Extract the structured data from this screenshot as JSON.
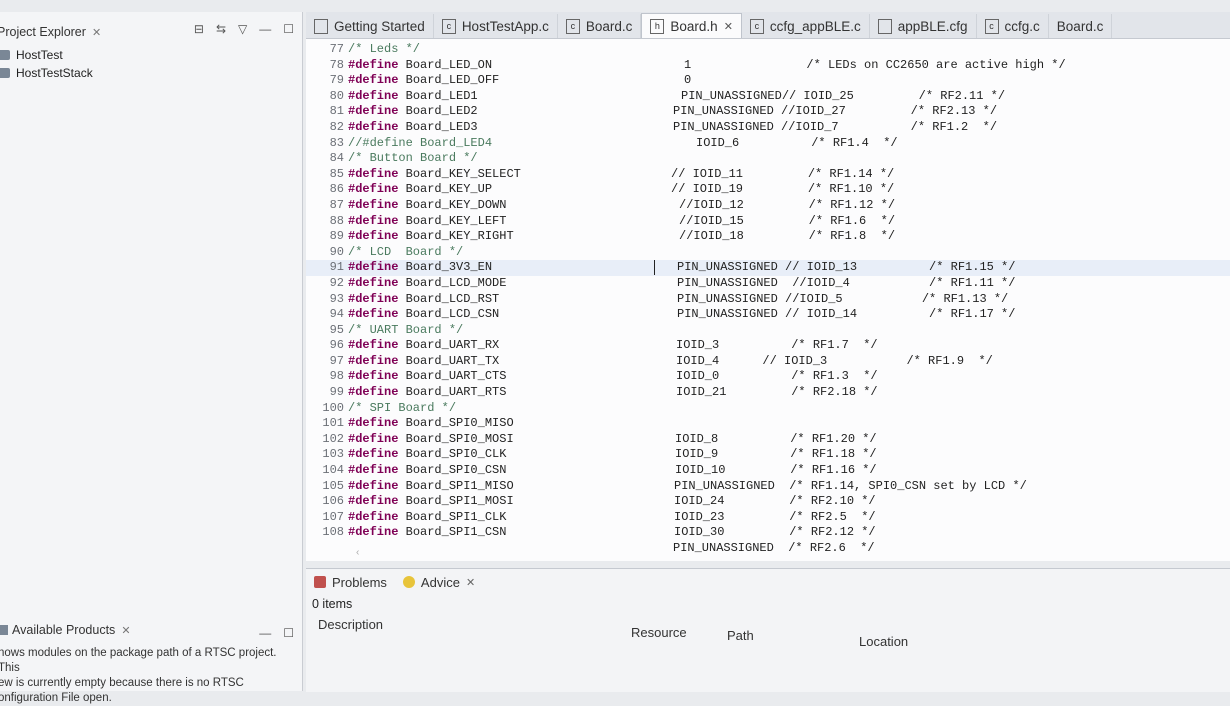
{
  "project_explorer": {
    "title": "Project Explorer",
    "close": "✕",
    "items": [
      "HostTest",
      "HostTestStack"
    ]
  },
  "available_products": {
    "title": "Available Products",
    "close": "✕",
    "message": [
      "nows modules on the package path of a RTSC project. This",
      "ew is currently empty because there is no RTSC",
      "onfiguration File open."
    ]
  },
  "editor_tabs": [
    {
      "label": "Getting Started"
    },
    {
      "label": "HostTestApp.c"
    },
    {
      "label": "Board.c"
    },
    {
      "label": "Board.h",
      "close": "✕"
    },
    {
      "label": "ccfg_appBLE.c"
    },
    {
      "label": "appBLE.cfg"
    },
    {
      "label": "ccfg.c"
    },
    {
      "label": "Board.c"
    }
  ],
  "code_lines": [
    {
      "n": "77",
      "pre": "",
      "src": "/* Leds */",
      "kind": "c",
      "val": "",
      "vx": 0
    },
    {
      "n": "78",
      "pre": "#define",
      "src": " Board_LED_ON",
      "val": "1                /* LEDs on CC2650 are active high */",
      "vx": 378
    },
    {
      "n": "79",
      "pre": "#define",
      "src": " Board_LED_OFF",
      "val": "0",
      "vx": 378
    },
    {
      "n": "80",
      "pre": "#define",
      "src": " Board_LED1",
      "val": "PIN_UNASSIGNED// IOID_25         /* RF2.11 */",
      "vx": 375
    },
    {
      "n": "81",
      "pre": "#define",
      "src": " Board_LED2",
      "val": "PIN_UNASSIGNED //IOID_27         /* RF2.13 */",
      "vx": 367
    },
    {
      "n": "82",
      "pre": "#define",
      "src": " Board_LED3",
      "val": "PIN_UNASSIGNED //IOID_7          /* RF1.2  */",
      "vx": 367
    },
    {
      "n": "83",
      "pre": "",
      "src": "//#define Board_LED4",
      "kind": "c",
      "val": "IOID_6          /* RF1.4  */",
      "vx": 390
    },
    {
      "n": "84",
      "pre": "",
      "src": "/* Button Board */",
      "kind": "c",
      "val": "",
      "vx": 0
    },
    {
      "n": "85",
      "pre": "#define",
      "src": " Board_KEY_SELECT",
      "val": "// IOID_11         /* RF1.14 */",
      "vx": 365
    },
    {
      "n": "86",
      "pre": "#define",
      "src": " Board_KEY_UP",
      "val": "// IOID_19         /* RF1.10 */",
      "vx": 365
    },
    {
      "n": "87",
      "pre": "#define",
      "src": " Board_KEY_DOWN",
      "val": "//IOID_12         /* RF1.12 */",
      "vx": 373
    },
    {
      "n": "88",
      "pre": "#define",
      "src": " Board_KEY_LEFT",
      "val": "//IOID_15         /* RF1.6  */",
      "vx": 373
    },
    {
      "n": "89",
      "pre": "#define",
      "src": " Board_KEY_RIGHT",
      "val": "//IOID_18         /* RF1.8  */",
      "vx": 373
    },
    {
      "n": "90",
      "pre": "",
      "src": "/* LCD  Board */",
      "kind": "c",
      "val": "",
      "vx": 0
    },
    {
      "n": "91",
      "pre": "#define",
      "src": " Board_3V3_EN",
      "val": "PIN_UNASSIGNED // IOID_13          /* RF1.15 */",
      "vx": 371,
      "hl": true
    },
    {
      "n": "92",
      "pre": "#define",
      "src": " Board_LCD_MODE",
      "val": "PIN_UNASSIGNED  //IOID_4           /* RF1.11 */",
      "vx": 371
    },
    {
      "n": "93",
      "pre": "#define",
      "src": " Board_LCD_RST",
      "val": "PIN_UNASSIGNED //IOID_5           /* RF1.13 */",
      "vx": 371
    },
    {
      "n": "94",
      "pre": "#define",
      "src": " Board_LCD_CSN",
      "val": "PIN_UNASSIGNED // IOID_14          /* RF1.17 */",
      "vx": 371
    },
    {
      "n": "95",
      "pre": "",
      "src": "/* UART Board */",
      "kind": "c",
      "val": "",
      "vx": 0
    },
    {
      "n": "96",
      "pre": "#define",
      "src": " Board_UART_RX",
      "val": "IOID_3          /* RF1.7  */",
      "vx": 370
    },
    {
      "n": "97",
      "pre": "#define",
      "src": " Board_UART_TX",
      "val": "IOID_4      // IOID_3           /* RF1.9  */",
      "vx": 370
    },
    {
      "n": "98",
      "pre": "#define",
      "src": " Board_UART_CTS",
      "val": "IOID_0          /* RF1.3  */",
      "vx": 370
    },
    {
      "n": "99",
      "pre": "#define",
      "src": " Board_UART_RTS",
      "val": "IOID_21         /* RF2.18 */",
      "vx": 370
    },
    {
      "n": "100",
      "pre": "",
      "src": "/* SPI Board */",
      "kind": "c",
      "val": "",
      "vx": 0
    },
    {
      "n": "101",
      "pre": "#define",
      "src": " Board_SPI0_MISO",
      "val": "",
      "vx": 0
    },
    {
      "n": "102",
      "pre": "#define",
      "src": " Board_SPI0_MOSI",
      "val": "IOID_8          /* RF1.20 */",
      "vx": 369
    },
    {
      "n": "103",
      "pre": "#define",
      "src": " Board_SPI0_CLK",
      "val": "IOID_9          /* RF1.18 */",
      "vx": 369
    },
    {
      "n": "104",
      "pre": "#define",
      "src": " Board_SPI0_CSN",
      "val": "IOID_10         /* RF1.16 */",
      "vx": 369
    },
    {
      "n": "105",
      "pre": "#define",
      "src": " Board_SPI1_MISO",
      "val": "PIN_UNASSIGNED  /* RF1.14, SPI0_CSN set by LCD */",
      "vx": 368
    },
    {
      "n": "106",
      "pre": "#define",
      "src": " Board_SPI1_MOSI",
      "val": "IOID_24         /* RF2.10 */",
      "vx": 368
    },
    {
      "n": "107",
      "pre": "#define",
      "src": " Board_SPI1_CLK",
      "val": "IOID_23         /* RF2.5  */",
      "vx": 368
    },
    {
      "n": "108",
      "pre": "#define",
      "src": " Board_SPI1_CSN",
      "val": "IOID_30         /* RF2.12 */",
      "vx": 368
    },
    {
      "n": "",
      "pre": "",
      "src": "",
      "val": "PIN_UNASSIGNED  /* RF2.6  */",
      "vx": 367
    }
  ],
  "bottom_panel": {
    "tabs": [
      {
        "label": "Problems"
      },
      {
        "label": "Advice",
        "close": "✕"
      }
    ],
    "items_count": "0 items",
    "columns": [
      "Description",
      "Resource",
      "Path",
      "Location"
    ]
  }
}
